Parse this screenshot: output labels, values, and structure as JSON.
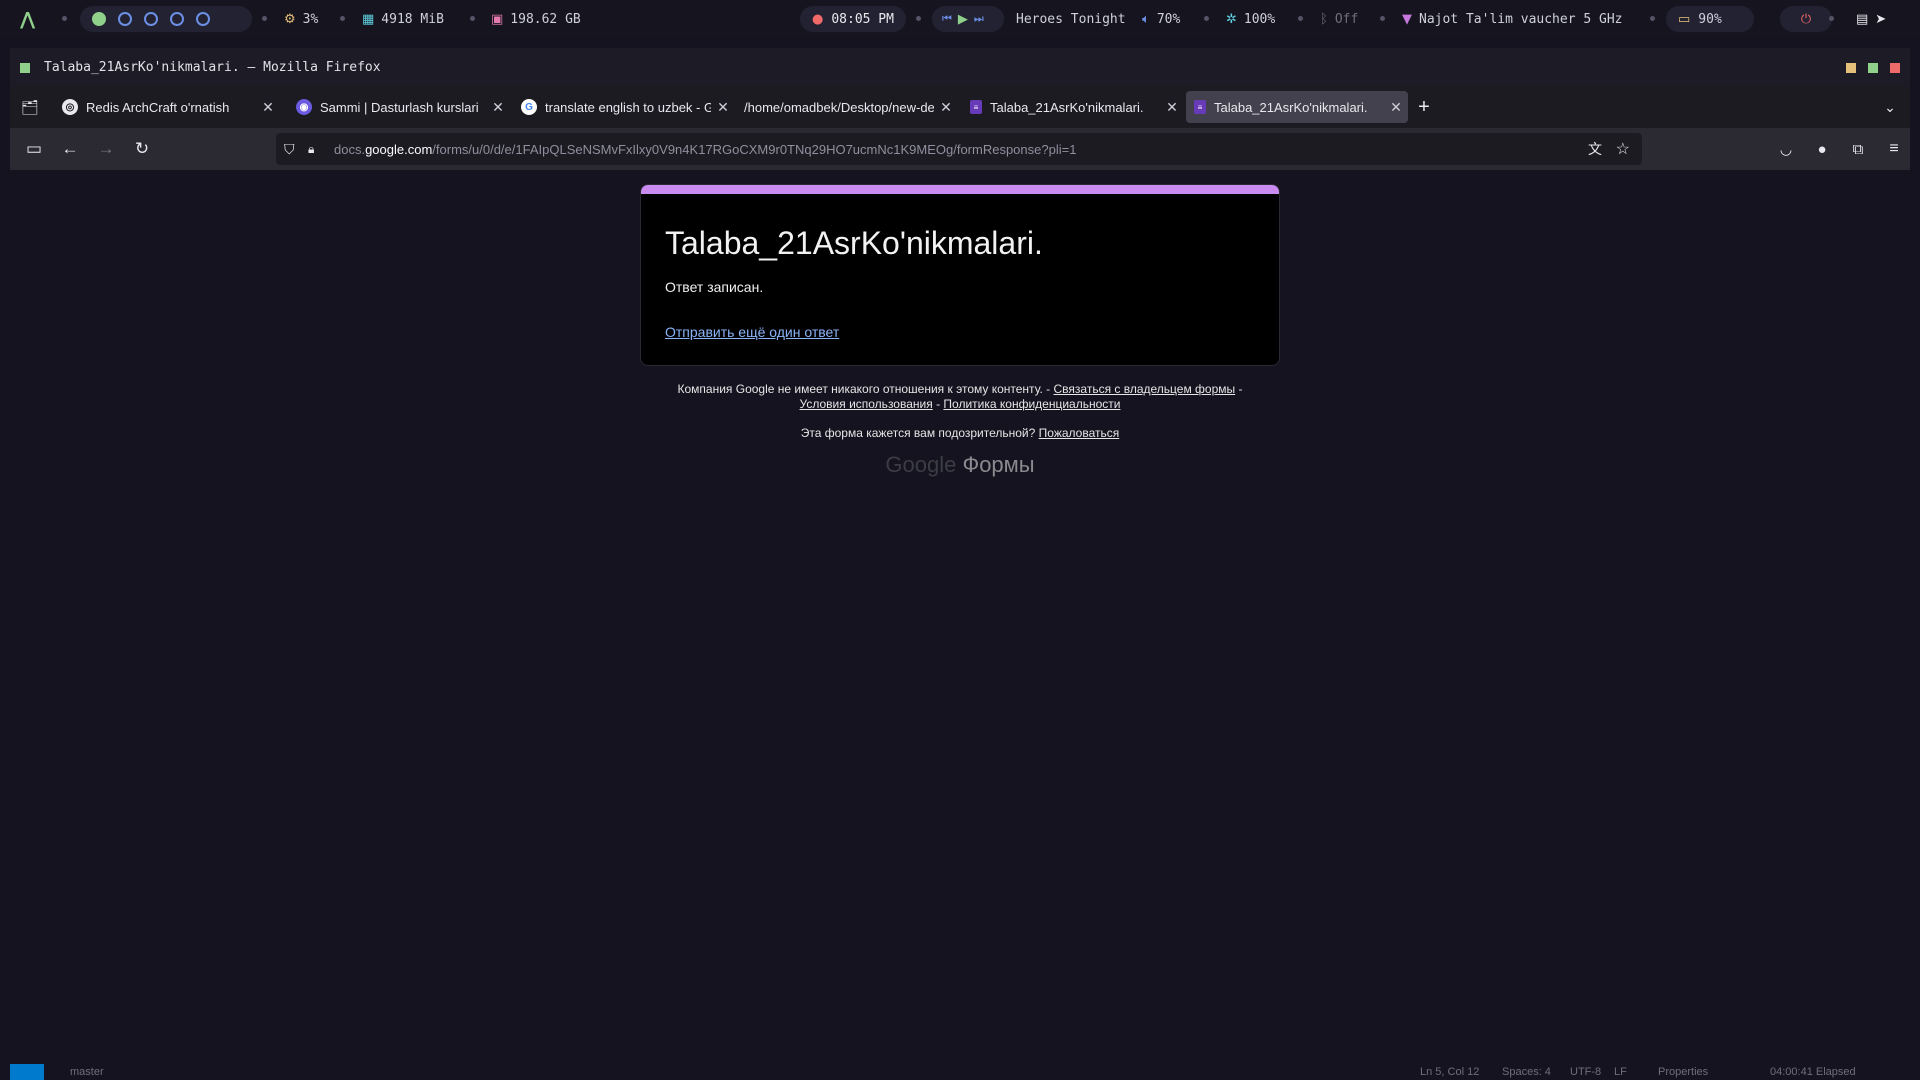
{
  "system_bar": {
    "cpu": "3%",
    "memory": "4918 MiB",
    "disk": "198.62 GB",
    "clock": "08:05 PM",
    "music_title": "Heroes Tonight",
    "volume": "70%",
    "brightness": "100%",
    "bluetooth": "Off",
    "wifi": "Najot Ta'lim vaucher 5 GHz",
    "battery": "90%"
  },
  "window": {
    "title": "Talaba_21AsrKo'nikmalari. — Mozilla Firefox"
  },
  "tabs": [
    {
      "label": "Redis ArchCraft o'rnatish",
      "favicon": "redis-icon",
      "close": "✕"
    },
    {
      "label": "Sammi | Dasturlash kurslari",
      "favicon": "sammi-icon",
      "close": "✕"
    },
    {
      "label": "translate english to uzbek - Go",
      "favicon": "google-icon",
      "close": "✕"
    },
    {
      "label": "/home/omadbek/Desktop/new-de",
      "favicon": "",
      "close": "✕"
    },
    {
      "label": "Talaba_21AsrKo'nikmalari.",
      "favicon": "forms-icon",
      "close": "✕"
    },
    {
      "label": "Talaba_21AsrKo'nikmalari.",
      "favicon": "forms-icon",
      "close": "✕"
    }
  ],
  "url": {
    "prefix": "docs.",
    "domain": "google.com",
    "path": "/forms/u/0/d/e/1FAIpQLSeNSMvFxIlxy0V9n4K17RGoCXM9r0TNq29HO7ucmNc1K9MEOg/formResponse?pli=1"
  },
  "form": {
    "title": "Talaba_21AsrKo'nikmalari.",
    "message": "Ответ записан.",
    "another_link": "Отправить ещё один ответ"
  },
  "footer": {
    "disclaimer": "Компания Google не имеет никакого отношения к этому контенту. -",
    "contact_owner": "Связаться с владельцем формы",
    "dash": "-",
    "terms": "Условия использования",
    "privacy": "Политика конфиденциальности",
    "suspicious": "Эта форма кажется вам подозрительной?",
    "report": "Пожаловаться",
    "brand_google": "Google",
    "brand_forms": "Формы"
  },
  "status_bar": {
    "branch": "master",
    "position": "Ln 5, Col 12",
    "spaces": "Spaces: 4",
    "encoding": "UTF-8",
    "eol": "LF",
    "properties": "Properties",
    "elapsed": "04:00:41 Elapsed"
  },
  "colors": {
    "accent": "#c98bf0",
    "link": "#8ab4f8",
    "card": "#000000",
    "page_bg": "#14131f"
  }
}
